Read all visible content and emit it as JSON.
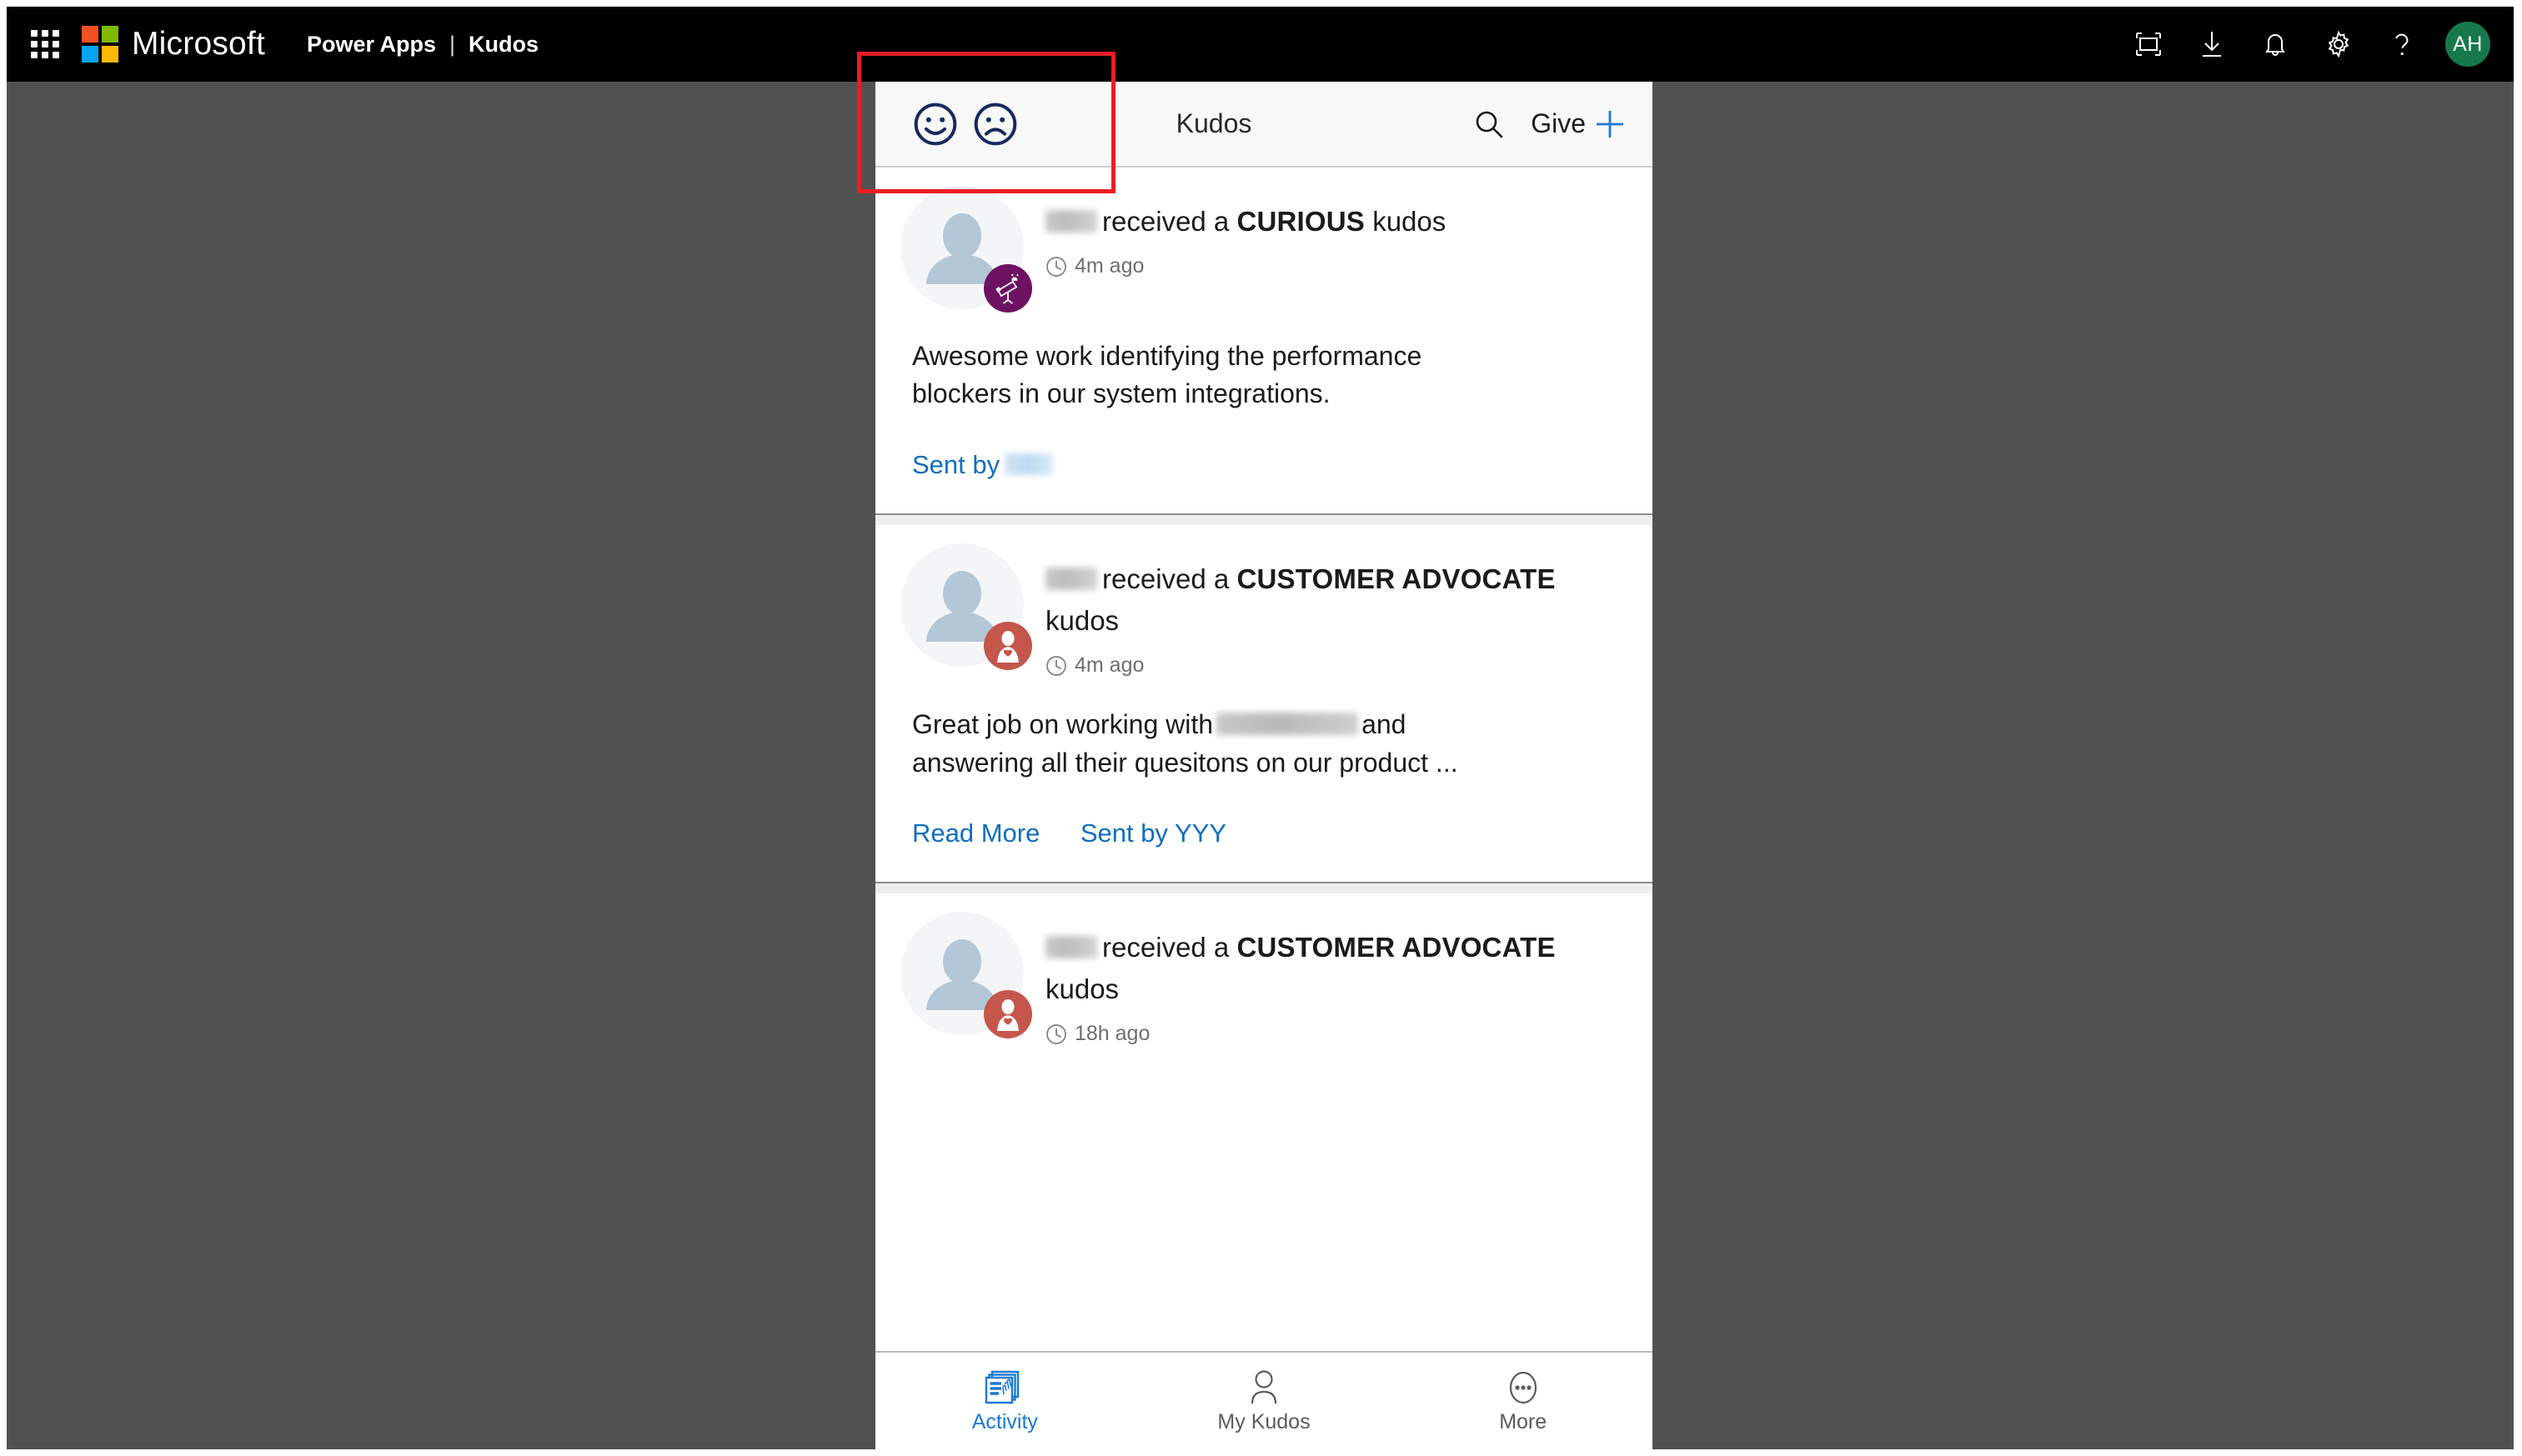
{
  "suite": {
    "brand": "Microsoft",
    "app_name": "Power Apps",
    "separator": "|",
    "page_name": "Kudos",
    "waffle_icon": "app-launcher-waffle-icon",
    "icons": [
      {
        "name": "fullscreen-icon",
        "label": "Fullscreen"
      },
      {
        "name": "download-icon",
        "label": "Download"
      },
      {
        "name": "bell-icon",
        "label": "Notifications"
      },
      {
        "name": "gear-icon",
        "label": "Settings"
      },
      {
        "name": "help-icon",
        "label": "Help"
      }
    ],
    "avatar_initials": "AH",
    "avatar_color": "#16794B"
  },
  "app": {
    "header": {
      "mood_happy_icon": "happy-face-icon",
      "mood_sad_icon": "sad-face-icon",
      "mood_color": "#19295E",
      "title": "Kudos",
      "search_icon": "search-icon",
      "give_label": "Give",
      "give_plus_icon": "plus-icon",
      "plus_color": "#1A79D1"
    },
    "feed": [
      {
        "avatar_icon": "person-placeholder-avatar",
        "badge_icon": "telescope-icon",
        "badge_color": "#6D1162",
        "recipient_name_redacted": true,
        "received_prefix": "received a",
        "kudos_type": "CURIOUS",
        "kudos_suffix": "kudos",
        "clock_icon": "clock-icon",
        "timestamp": "4m ago",
        "message": "Awesome work identifying the performance blockers in our system integrations.",
        "message_blur_word": false,
        "read_more": null,
        "sent_by_label": "Sent by",
        "sent_by_name": "",
        "sent_by_redacted": true
      },
      {
        "avatar_icon": "person-placeholder-avatar",
        "badge_icon": "customer-advocate-icon",
        "badge_color": "#C5564C",
        "recipient_name_redacted": true,
        "received_prefix": "received a",
        "kudos_type": "CUSTOMER ADVOCATE",
        "kudos_suffix": "kudos",
        "clock_icon": "clock-icon",
        "timestamp": "4m ago",
        "message_part1": "Great job on working with",
        "message_blur_word": true,
        "message_part2": "and answering all their quesitons on our product ...",
        "read_more": "Read More",
        "sent_by_label": "Sent by",
        "sent_by_name": "YYY",
        "sent_by_redacted": false
      },
      {
        "avatar_icon": "person-placeholder-avatar",
        "badge_icon": "customer-advocate-icon",
        "badge_color": "#C5564C",
        "recipient_name_redacted": true,
        "received_prefix": "received a",
        "kudos_type": "CUSTOMER ADVOCATE",
        "kudos_suffix": "kudos",
        "clock_icon": "clock-icon",
        "timestamp": "18h ago"
      }
    ],
    "bottom_nav": [
      {
        "label": "Activity",
        "icon": "activity-feed-icon",
        "active": true
      },
      {
        "label": "My Kudos",
        "icon": "person-outline-icon",
        "active": false
      },
      {
        "label": "More",
        "icon": "ellipsis-icon",
        "active": false
      }
    ]
  },
  "annotation": {
    "highlight_color": "#ED1C24",
    "target": "mood-buttons-region"
  }
}
